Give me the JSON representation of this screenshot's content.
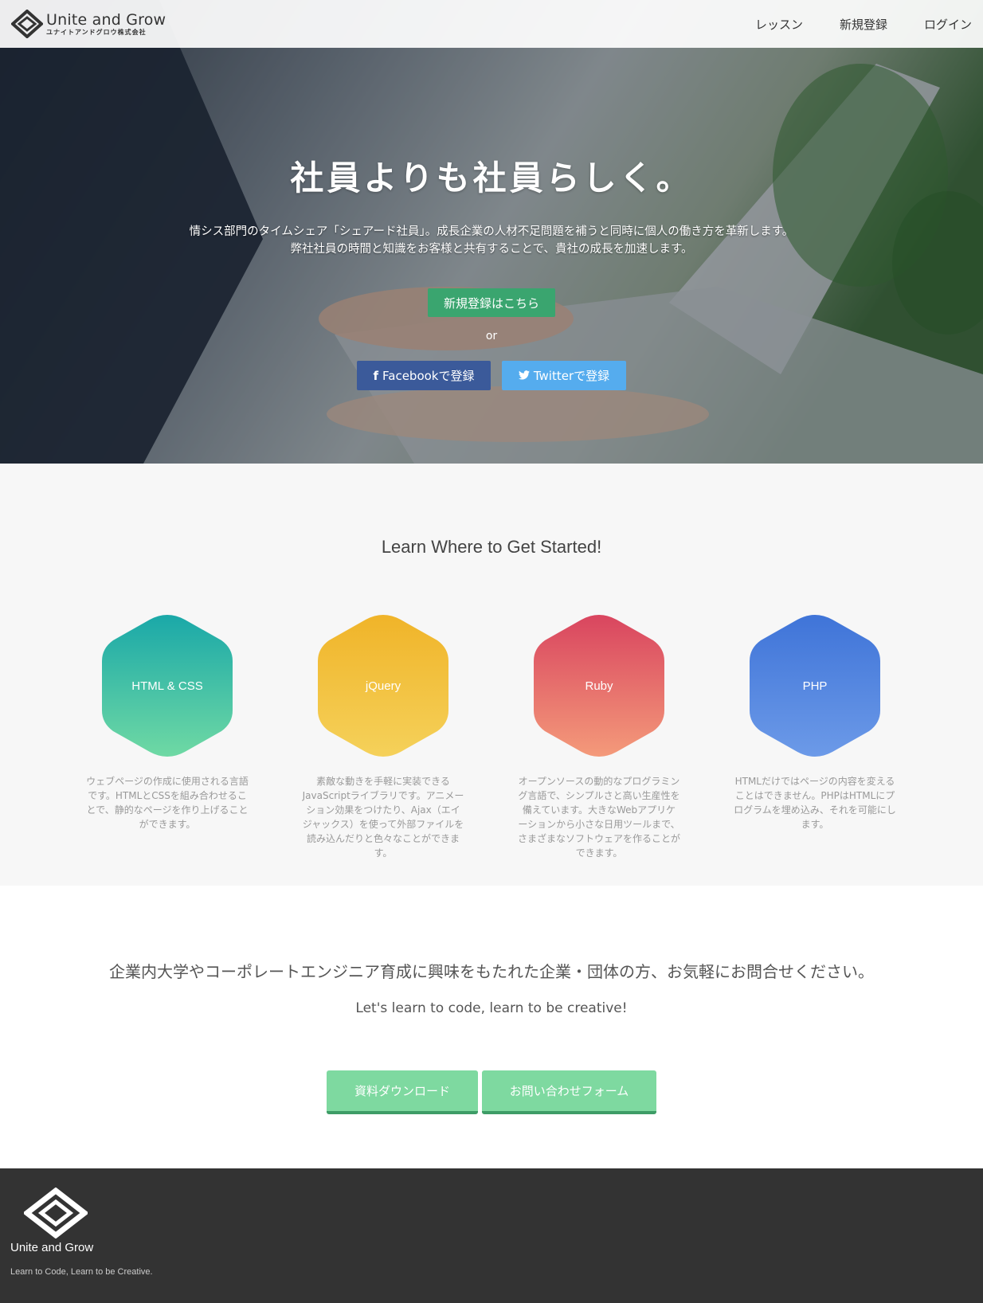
{
  "header": {
    "logo_title": "Unite and Grow",
    "logo_sub": "ユナイトアンドグロウ株式会社",
    "nav": [
      "レッスン",
      "新規登録",
      "ログイン"
    ]
  },
  "hero": {
    "title": "社員よりも社員らしく。",
    "desc_line1": "情シス部門のタイムシェア「シェアード社員」。成長企業の人材不足問題を補うと同時に個人の働き方を革新します。",
    "desc_line2": "弊社社員の時間と知識をお客様と共有することで、貴社の成長を加速します。",
    "signup_button": "新規登録はこちら",
    "or_text": "or",
    "facebook_button": "Facebookで登録",
    "twitter_button": "Twitterで登録",
    "facebook_icon": "f",
    "twitter_icon": "🐦"
  },
  "lessons": {
    "heading": "Learn Where to Get Started!",
    "items": [
      {
        "label": "HTML & CSS",
        "desc": "ウェブページの作成に使用される言語です。HTMLとCSSを組み合わせることで、静的なページを作り上げることができます。",
        "color_top": "#1aa8a8",
        "color_bottom": "#6fd9a4"
      },
      {
        "label": "jQuery",
        "desc": "素敵な動きを手軽に実装できるJavaScriptライブラリです。アニメーション効果をつけたり、Ajax（エイジャックス）を使って外部ファイルを読み込んだりと色々なことができます。",
        "color_top": "#f0b429",
        "color_bottom": "#f5d15a"
      },
      {
        "label": "Ruby",
        "desc": "オープンソースの動的なプログラミング言語で、シンプルさと高い生産性を備えています。大きなWebアプリケーションから小さな日用ツールまで、さまざまなソフトウェアを作ることができます。",
        "color_top": "#d9455f",
        "color_bottom": "#f49a7a"
      },
      {
        "label": "PHP",
        "desc": "HTMLだけではページの内容を変えることはできません。PHPはHTMLにプログラムを埋め込み、それを可能にします。",
        "color_top": "#3f74d8",
        "color_bottom": "#6c9ae8"
      }
    ]
  },
  "contact": {
    "heading": "企業内大学やコーポレートエンジニア育成に興味をもたれた企業・団体の方、お気軽にお問合せください。",
    "sub": "Let's learn to code, learn to be creative!",
    "download_button": "資料ダウンロード",
    "form_button": "お問い合わせフォーム"
  },
  "footer": {
    "name": "Unite and Grow",
    "tagline": "Learn to Code, Learn to be Creative."
  }
}
